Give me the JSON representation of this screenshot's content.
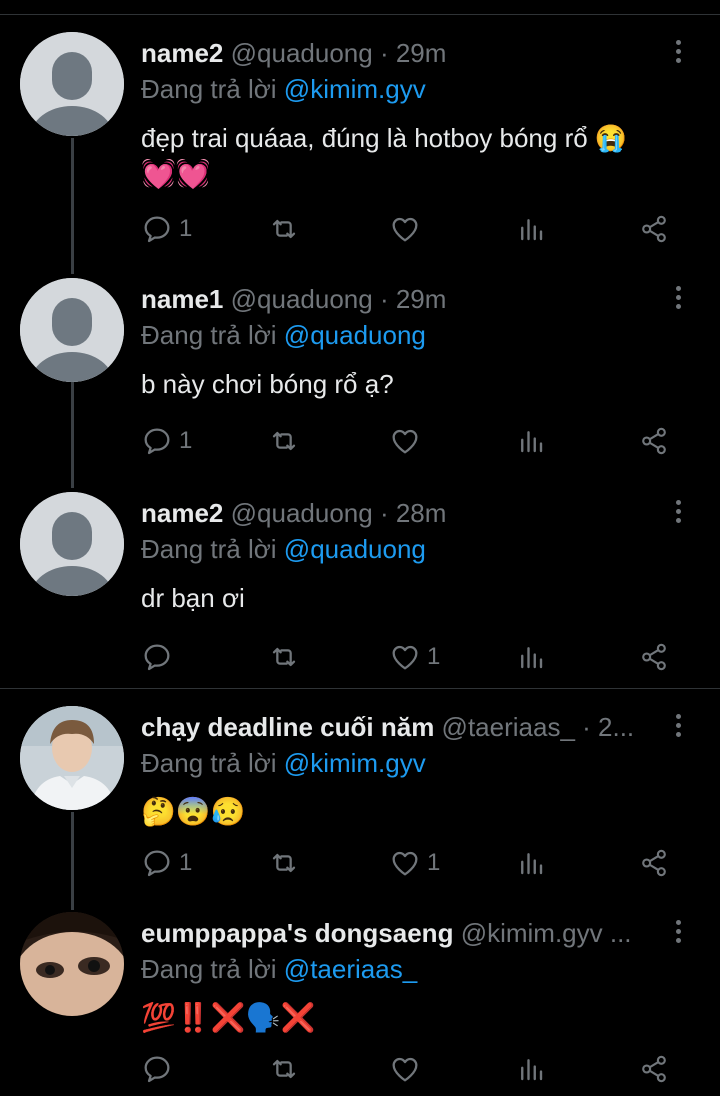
{
  "tweets": [
    {
      "name": "name2",
      "handle": "@quaduong",
      "time": "· 29m",
      "reply_prefix": "Đang trả lời",
      "reply_to": "@kimim.gyv",
      "text_line1": "đẹp trai quáaa, đúng là hotboy bóng rổ 😭",
      "text_line2": "💓💓",
      "reply_count": "1",
      "like_count": ""
    },
    {
      "name": "name1",
      "handle": "@quaduong",
      "time": "· 29m",
      "reply_prefix": "Đang trả lời",
      "reply_to": "@quaduong",
      "text_line1": "b này chơi bóng rổ ạ?",
      "reply_count": "1",
      "like_count": ""
    },
    {
      "name": "name2",
      "handle": "@quaduong",
      "time": "· 28m",
      "reply_prefix": "Đang trả lời",
      "reply_to": "@quaduong",
      "text_line1": "dr bạn ơi",
      "reply_count": "",
      "like_count": "1"
    },
    {
      "name": "chạy deadline cuối năm",
      "handle": "@taeriaas_",
      "time": "· 2...",
      "reply_prefix": "Đang trả lời",
      "reply_to": "@kimim.gyv",
      "text_line1": "🤔😨😥",
      "reply_count": "1",
      "like_count": "1"
    },
    {
      "name": "eumppappa's dongsaeng",
      "handle": "@kimim.gyv ...",
      "time": "",
      "reply_prefix": "Đang trả lời",
      "reply_to": "@taeriaas_",
      "text_line1": "💯‼️❌🗣️❌",
      "reply_count": "",
      "like_count": ""
    }
  ],
  "icons": {
    "reply": "reply-icon",
    "retweet": "retweet-icon",
    "like": "heart-icon",
    "views": "views-icon",
    "share": "share-icon",
    "more": "more-icon"
  },
  "colors": {
    "background": "#000000",
    "text": "#e7e9ea",
    "muted": "#71767b",
    "mention": "#1d9bf0",
    "thread_line": "#3a3f44",
    "avatar_placeholder": "#d4d8dc",
    "avatar_figure": "#6e7881"
  }
}
